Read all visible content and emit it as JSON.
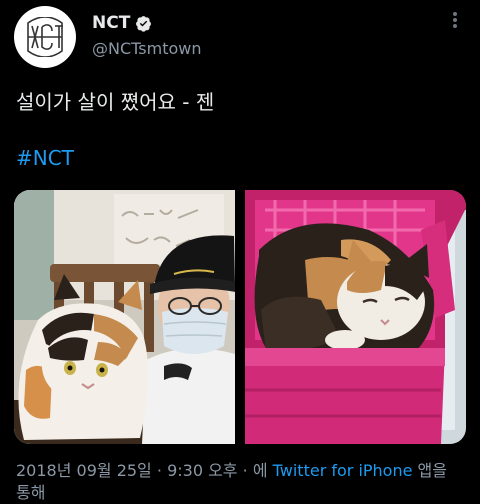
{
  "account": {
    "display_name": "NCT",
    "handle": "@NCTsmtown",
    "verified": true,
    "avatar_icon": "nct-logo-icon"
  },
  "tweet": {
    "text": "설이가 살이 쪘어요 - 젠",
    "hashtag": "#NCT"
  },
  "media": {
    "photos": [
      {
        "name": "photo-cat-with-person",
        "icon": "photo"
      },
      {
        "name": "photo-cat-in-basket",
        "icon": "photo"
      }
    ]
  },
  "meta": {
    "date": "2018년 09월 25일",
    "time": "9:30 오후",
    "via_prefix": "에",
    "source": "Twitter for iPhone",
    "via_suffix": "앱을 통해"
  },
  "colors": {
    "background": "#000000",
    "text": "#e7e9ea",
    "secondary": "#8b98a5",
    "accent": "#1d9bf0"
  }
}
